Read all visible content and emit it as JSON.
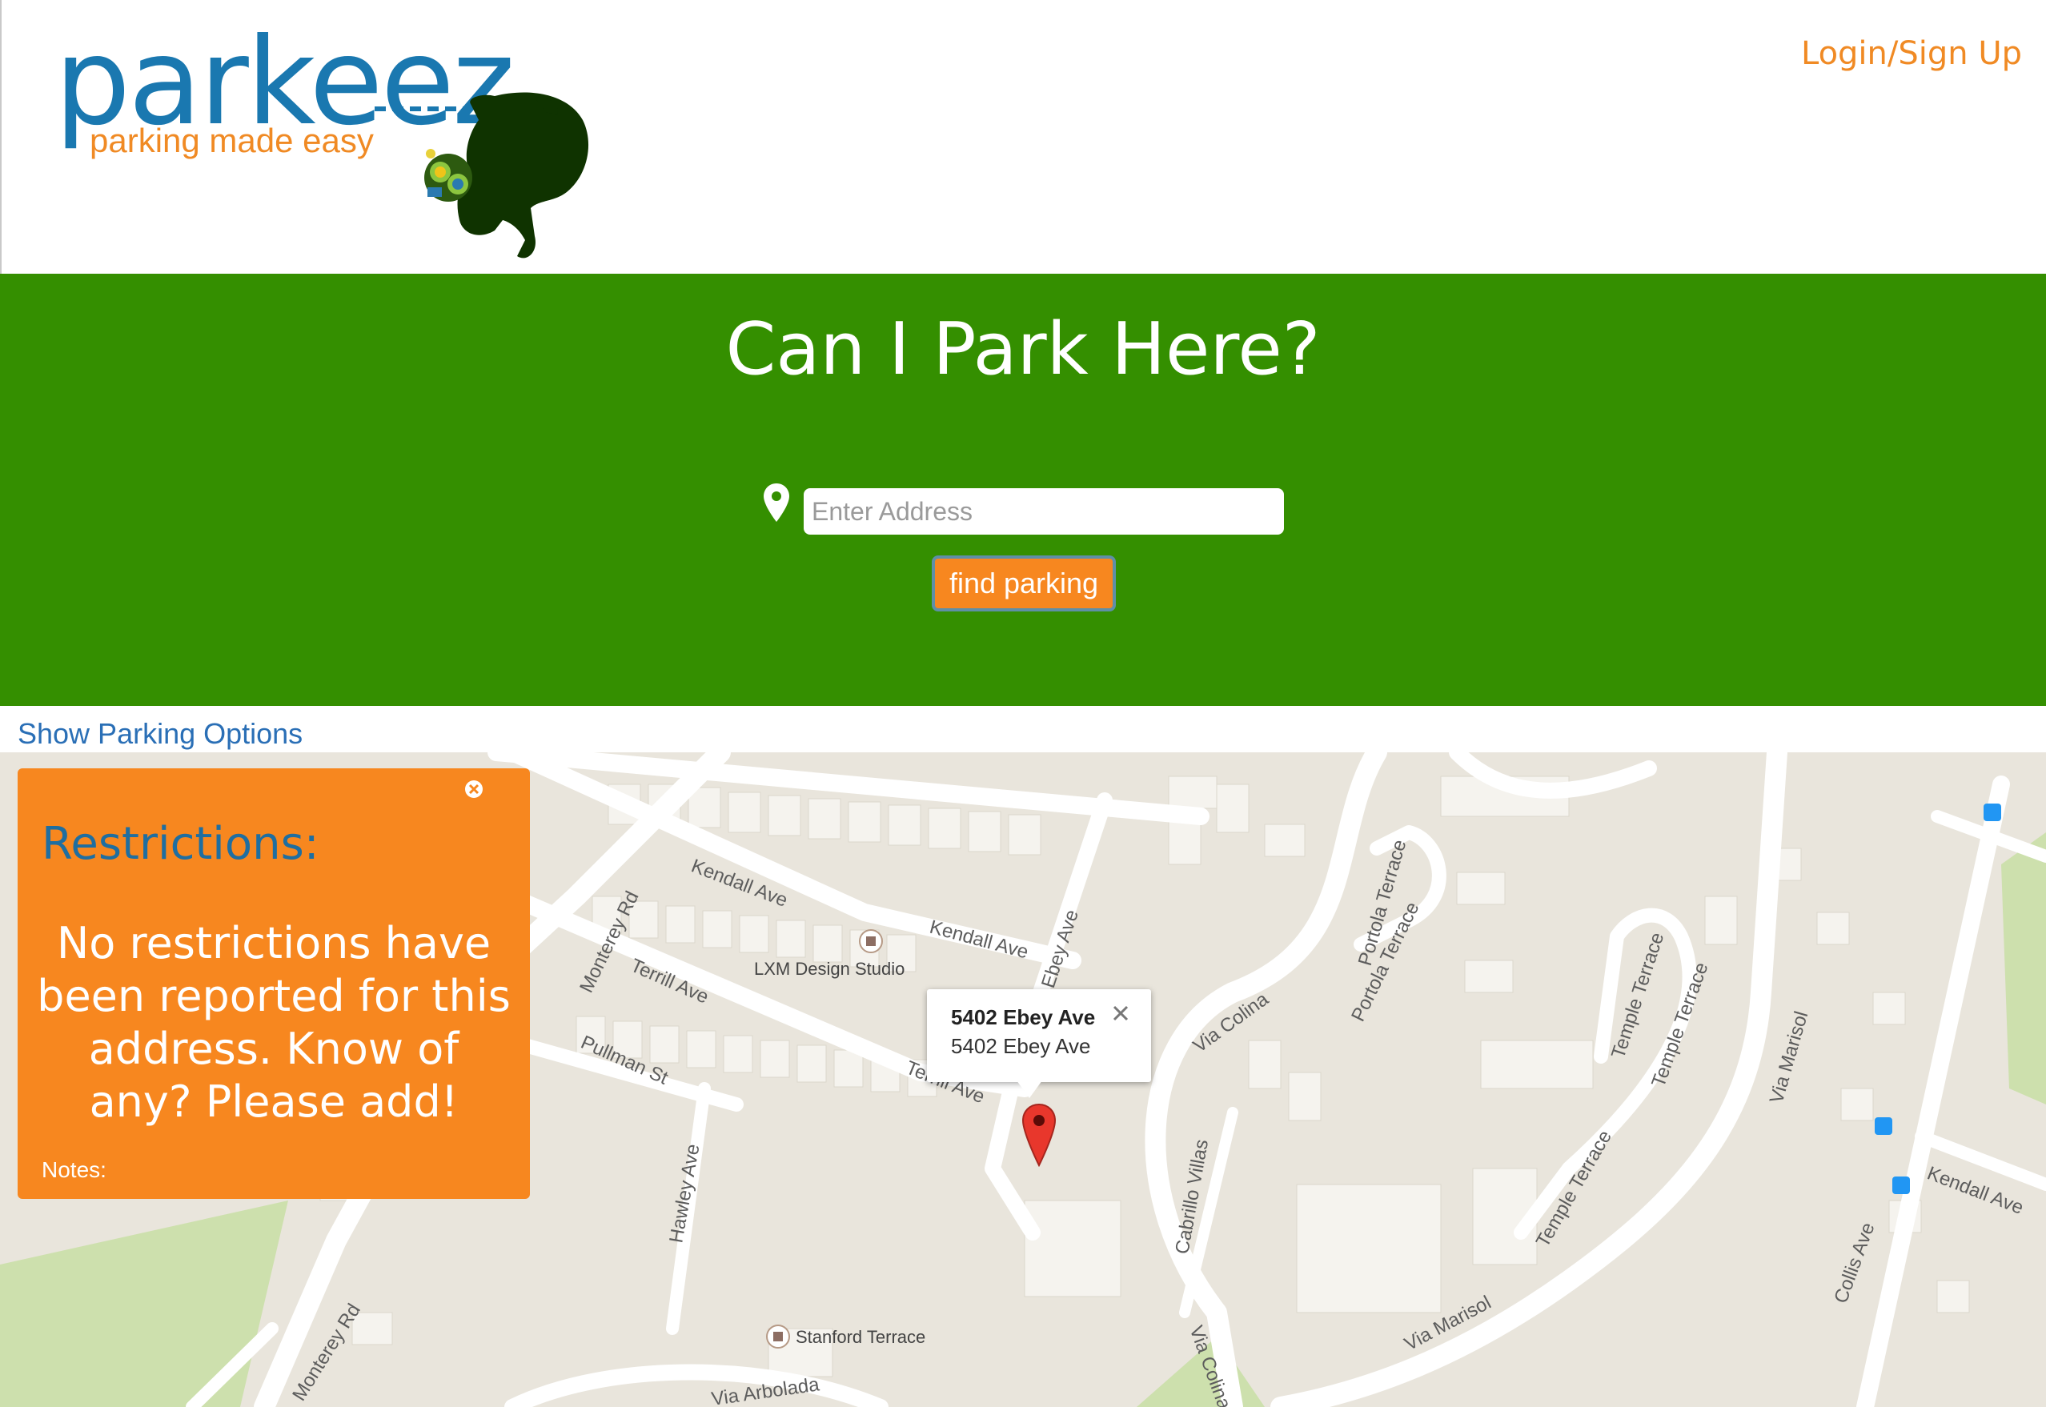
{
  "header": {
    "logo_word": "parkeez",
    "logo_tagline": "parking made easy",
    "login_label": "Login/Sign Up"
  },
  "hero": {
    "title": "Can I Park Here?",
    "address_placeholder": "Enter Address",
    "address_value": "",
    "find_button_label": "find parking"
  },
  "options": {
    "show_label": "Show Parking Options"
  },
  "restrictions": {
    "title": "Restrictions:",
    "message": "No restrictions have been reported for this address. Know of any? Please add!",
    "notes_label": "Notes:"
  },
  "info_window": {
    "title": "5402 Ebey Ave",
    "address": "5402 Ebey Ave"
  },
  "map": {
    "streets": {
      "kendall_ave_1": "Kendall Ave",
      "kendall_ave_2": "Kendall Ave",
      "kendall_ave_3": "Kendall Ave",
      "terrill_ave_1": "Terrill Ave",
      "terrill_ave_2": "Terrill Ave",
      "monterey_rd_1": "Monterey Rd",
      "monterey_rd_2": "Monterey Rd",
      "pullman_st": "Pullman St",
      "hawley_ave": "Hawley Ave",
      "ebey_ave": "Ebey Ave",
      "via_colina_1": "Via Colina",
      "via_colina_2": "Via Colina",
      "portola_terrace_1": "Portola Terrace",
      "portola_terrace_2": "Portola Terrace",
      "temple_terrace_1": "Temple Terrace",
      "temple_terrace_2": "Temple Terrace",
      "temple_terrace_3": "Temple Terrace",
      "cabrillo_villas": "Cabrillo Villas",
      "via_marisol_1": "Via Marisol",
      "via_marisol_2": "Via Marisol",
      "via_arbolada": "Via Arbolada",
      "collis_ave": "Collis Ave"
    },
    "pois": {
      "lxm": "LXM Design Studio",
      "stanford_terrace": "Stanford Terrace"
    },
    "colors": {
      "land": "#e9e5dc",
      "road": "#ffffff",
      "park": "#cde0ad",
      "building": "#f5f3ee"
    }
  },
  "colors": {
    "brand_blue": "#1a78b0",
    "brand_orange": "#f08a24",
    "hero_green": "#348f00",
    "panel_orange": "#f7871f"
  }
}
